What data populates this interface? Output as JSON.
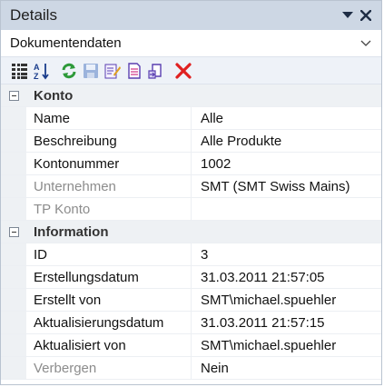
{
  "panel": {
    "title": "Details",
    "dropdown_icon": "triangle-down-icon",
    "close_icon": "close-icon"
  },
  "selector": {
    "value": "Dokumentendaten",
    "icon": "chevron-down-icon"
  },
  "toolbar": {
    "icons": [
      "categorized-view-icon",
      "sort-alphabetical-icon",
      "refresh-icon",
      "save-icon",
      "edit-icon",
      "new-document-icon",
      "copy-document-icon",
      "delete-icon"
    ]
  },
  "grid": {
    "categories": [
      {
        "label": "Konto",
        "rows": [
          {
            "name": "Name",
            "value": "Alle",
            "disabled": false
          },
          {
            "name": "Beschreibung",
            "value": "Alle Produkte",
            "disabled": false
          },
          {
            "name": "Kontonummer",
            "value": "1002",
            "disabled": false
          },
          {
            "name": "Unternehmen",
            "value": "SMT (SMT Swiss Mains)",
            "disabled": true
          },
          {
            "name": "TP Konto",
            "value": "",
            "disabled": true
          }
        ]
      },
      {
        "label": "Information",
        "rows": [
          {
            "name": "ID",
            "value": "3",
            "disabled": false
          },
          {
            "name": "Erstellungsdatum",
            "value": "31.03.2011 21:57:05",
            "disabled": false
          },
          {
            "name": "Erstellt von",
            "value": "SMT\\michael.spuehler",
            "disabled": false
          },
          {
            "name": "Aktualisierungsdatum",
            "value": "31.03.2011 21:57:15",
            "disabled": false
          },
          {
            "name": "Aktualisiert von",
            "value": "SMT\\michael.spuehler",
            "disabled": false
          },
          {
            "name": "Verbergen",
            "value": "Nein",
            "disabled": true
          }
        ]
      }
    ]
  },
  "colors": {
    "title_bar": "#cdd7e4",
    "category_bg": "#eef1f4",
    "disabled_text": "#8c8c8c",
    "delete_red": "#e02020"
  }
}
